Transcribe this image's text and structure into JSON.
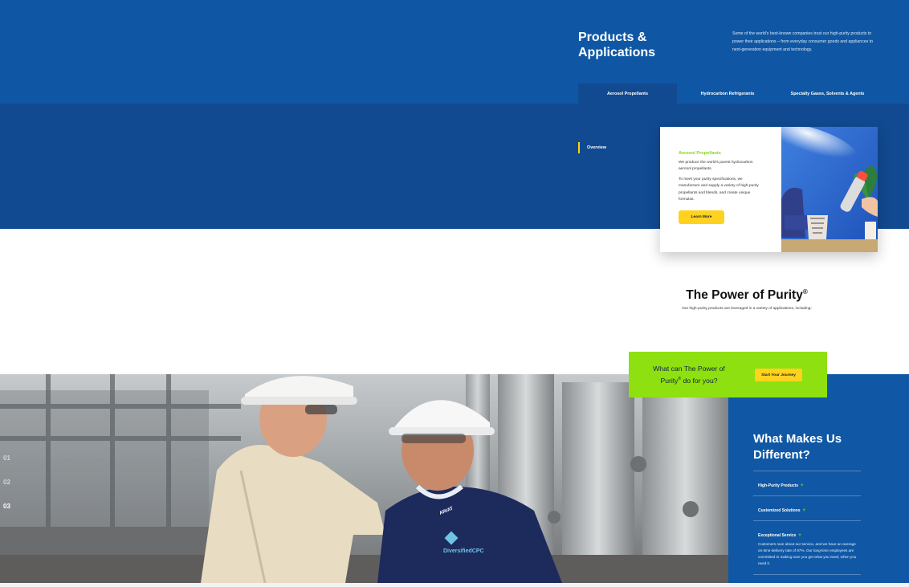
{
  "products": {
    "title": "Products & Applications",
    "description": "Some of the world's best-known companies trust our high-purity products to power their applications – from everyday consumer goods and appliances to next-generation equipment and technology.",
    "tabs": [
      {
        "label": "Aerosol Propellants",
        "active": true
      },
      {
        "label": "Hydrocarbon Refrigerants",
        "active": false
      },
      {
        "label": "Specialty Gases, Solvents & Agents",
        "active": false
      }
    ],
    "overview_label": "Overview"
  },
  "card": {
    "heading": "Aerosol Propellants",
    "paragraph1": "We produce the world's purest hydrocarbon aerosol propellants.",
    "paragraph2": "To meet your purity specifications, we manufacture and supply a variety of high-purity propellants and blends, and create unique formulas.",
    "button_label": "Learn More"
  },
  "power": {
    "title": "The Power of Purity",
    "title_mark": "®",
    "subtitle": "Our high-purity products are leveraged in a variety of applications, including:"
  },
  "cta": {
    "text_before": "What can The Power of Purity",
    "text_mark": "®",
    "text_after": " do for you?",
    "button_label": "Start Your Journey"
  },
  "hero": {
    "slides": [
      "01",
      "02",
      "03"
    ],
    "active_slide": "03",
    "logo_text": "DiversifiedCPC",
    "shirt_text": "ARIAT"
  },
  "different": {
    "title": "What Makes Us Different?",
    "items": [
      {
        "label": "High-Purity Products",
        "toggle": "+",
        "description": ""
      },
      {
        "label": "Customized Solutions",
        "toggle": "+",
        "description": ""
      },
      {
        "label": "Exceptional Service",
        "toggle": "+",
        "description": "Customers rave about our service, and we have an average on-time-delivery rate of 97%. Our long-time employees are committed to making sure you get what you need, when you need it."
      }
    ]
  },
  "colors": {
    "brand_blue": "#0f57a4",
    "dark_blue": "#114a91",
    "accent_green": "#8ee010",
    "accent_yellow": "#ffd21f"
  }
}
